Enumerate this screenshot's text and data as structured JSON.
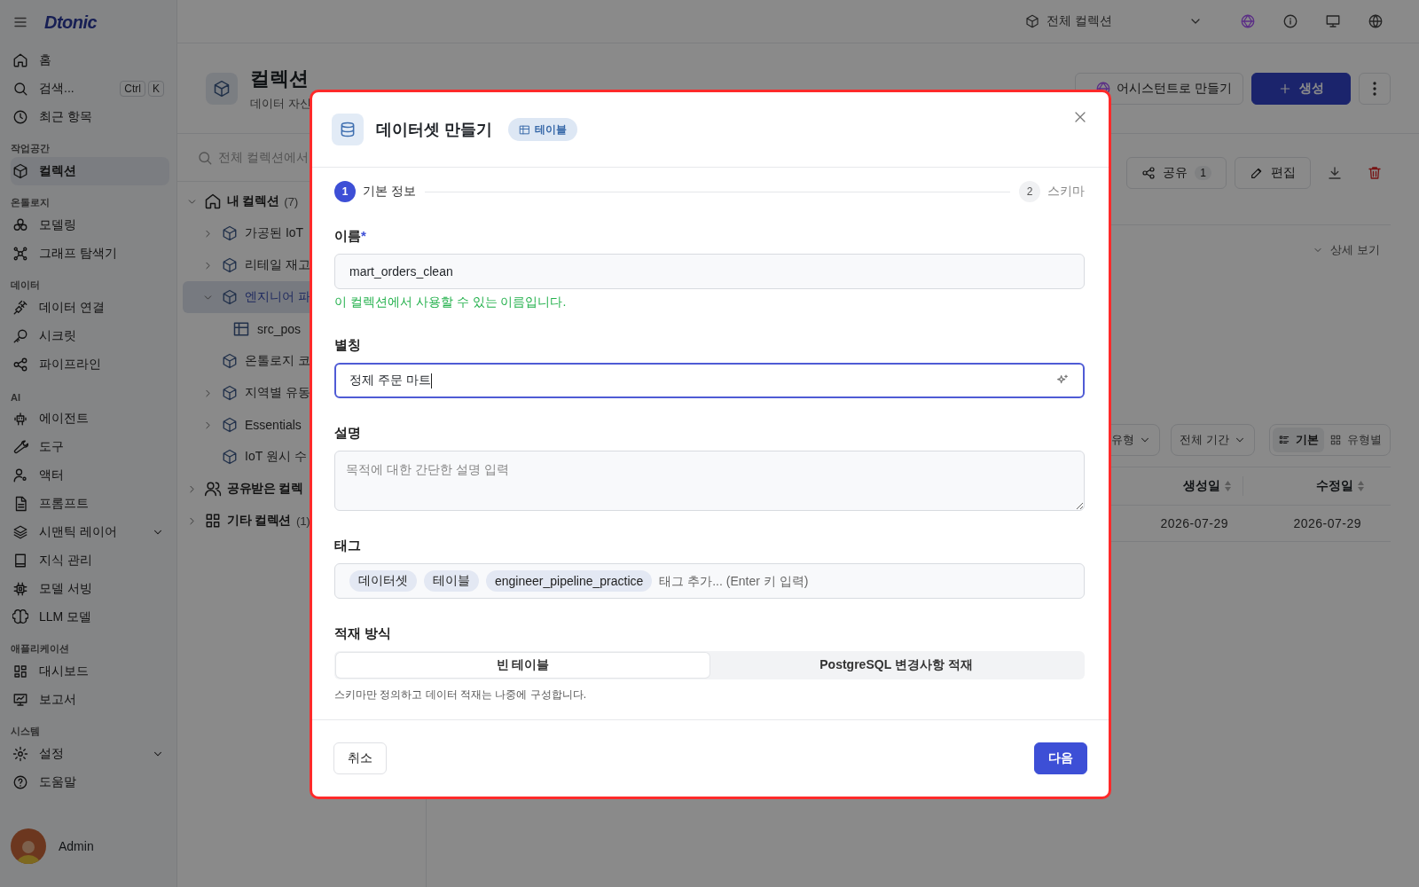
{
  "sidebar": {
    "logo": "Dtonic",
    "items": [
      {
        "kind": "item",
        "label": "홈",
        "selected": false,
        "submenu": false
      },
      {
        "kind": "item",
        "label": "검색...",
        "selected": false,
        "submenu": false,
        "shortcut": [
          "Ctrl",
          "K"
        ]
      },
      {
        "kind": "item",
        "label": "최근 항목",
        "selected": false,
        "submenu": false
      },
      {
        "kind": "section",
        "label": "작업공간"
      },
      {
        "kind": "item",
        "label": "컬렉션",
        "selected": true,
        "submenu": false
      },
      {
        "kind": "section",
        "label": "온톨로지"
      },
      {
        "kind": "item",
        "label": "모델링",
        "selected": false,
        "submenu": false
      },
      {
        "kind": "item",
        "label": "그래프 탐색기",
        "selected": false,
        "submenu": false
      },
      {
        "kind": "section",
        "label": "데이터"
      },
      {
        "kind": "item",
        "label": "데이터 연결",
        "selected": false,
        "submenu": false
      },
      {
        "kind": "item",
        "label": "시크릿",
        "selected": false,
        "submenu": false
      },
      {
        "kind": "item",
        "label": "파이프라인",
        "selected": false,
        "submenu": false
      },
      {
        "kind": "section",
        "label": "AI"
      },
      {
        "kind": "item",
        "label": "에이전트",
        "selected": false,
        "submenu": false
      },
      {
        "kind": "item",
        "label": "도구",
        "selected": false,
        "submenu": false
      },
      {
        "kind": "item",
        "label": "액터",
        "selected": false,
        "submenu": false
      },
      {
        "kind": "item",
        "label": "프롬프트",
        "selected": false,
        "submenu": false
      },
      {
        "kind": "item",
        "label": "시맨틱 레이어",
        "selected": false,
        "submenu": true
      },
      {
        "kind": "item",
        "label": "지식 관리",
        "selected": false,
        "submenu": false
      },
      {
        "kind": "item",
        "label": "모델 서빙",
        "selected": false,
        "submenu": false
      },
      {
        "kind": "item",
        "label": "LLM 모델",
        "selected": false,
        "submenu": false
      },
      {
        "kind": "section",
        "label": "애플리케이션"
      },
      {
        "kind": "item",
        "label": "대시보드",
        "selected": false,
        "submenu": false
      },
      {
        "kind": "item",
        "label": "보고서",
        "selected": false,
        "submenu": false
      },
      {
        "kind": "section",
        "label": "시스템"
      },
      {
        "kind": "item",
        "label": "설정",
        "selected": false,
        "submenu": true
      },
      {
        "kind": "item",
        "label": "도움말",
        "selected": false,
        "submenu": false
      }
    ],
    "user": {
      "name": "Admin"
    }
  },
  "topbar": {
    "scope": "전체 컬렉션"
  },
  "page": {
    "title": "컬렉션",
    "subtitle": "데이터 자신",
    "actions": [
      {
        "kind": "assistant",
        "label": "어시스턴트로 만들기"
      },
      {
        "kind": "primary",
        "label": "생성"
      },
      {
        "kind": "more"
      }
    ]
  },
  "tree": {
    "search_placeholder": "전체 컬렉션에서",
    "groups": [
      {
        "kind": "home",
        "label": "내 컬렉션",
        "count": "(7)",
        "expanded": true,
        "children": [
          {
            "label": "가공된 IoT",
            "has_children": true,
            "expanded": false,
            "selected": false
          },
          {
            "label": "리테일 재고",
            "has_children": true,
            "expanded": false,
            "selected": false
          },
          {
            "label": "엔지니어 파",
            "has_children": true,
            "expanded": true,
            "selected": true,
            "children": [
              {
                "label": "src_pos",
                "selected": false
              }
            ]
          },
          {
            "label": "온톨로지 코",
            "has_children": false,
            "expanded": false,
            "selected": false
          },
          {
            "label": "지역별 유동",
            "has_children": true,
            "expanded": false,
            "selected": false
          },
          {
            "label": "Essentials",
            "has_children": true,
            "expanded": false,
            "selected": false
          },
          {
            "label": "IoT 원시 수",
            "has_children": false,
            "expanded": false,
            "selected": false
          }
        ]
      },
      {
        "kind": "shared",
        "label": "공유받은 컬렉",
        "expanded": false
      },
      {
        "kind": "other",
        "label": "기타 컬렉션",
        "count": "(1)",
        "expanded": false
      }
    ]
  },
  "content": {
    "toolbar": [
      {
        "kind": "share",
        "label": "공유",
        "count": "1"
      },
      {
        "kind": "edit",
        "label": "편집"
      },
      {
        "kind": "download"
      },
      {
        "kind": "delete"
      }
    ],
    "detail_toggle": "상세 보기",
    "filters": [
      {
        "label": "유형"
      },
      {
        "label": "전체 기간"
      }
    ],
    "view_modes": [
      {
        "kind": "list",
        "label": "기본",
        "selected": true
      },
      {
        "kind": "grid",
        "label": "유형별",
        "selected": false
      }
    ],
    "table": {
      "columns": [
        "생성일",
        "수정일"
      ],
      "rows": [
        [
          "2026-07-29",
          "2026-07-29"
        ]
      ]
    }
  },
  "dialog": {
    "title": "데이터셋 만들기",
    "badge": "테이블",
    "steps": [
      {
        "number": "1",
        "label": "기본 정보",
        "selected": true
      },
      {
        "number": "2",
        "label": "스키마",
        "selected": false
      }
    ],
    "name": {
      "label": "이름",
      "required_mark": "*",
      "value": "mart_orders_clean",
      "hint": "이 컬렉션에서 사용할 수 있는 이름입니다."
    },
    "alias": {
      "label": "별칭",
      "value": "정제 주문 마트",
      "focused": true
    },
    "description": {
      "label": "설명",
      "placeholder": "목적에 대한 간단한 설명 입력"
    },
    "tags": {
      "label": "태그",
      "tags": [
        "데이터셋",
        "테이블",
        "engineer_pipeline_practice"
      ],
      "placeholder": "태그 추가... (Enter 키 입력)"
    },
    "load_mode": {
      "label": "적재 방식",
      "options": [
        {
          "label": "빈 테이블",
          "selected": true
        },
        {
          "label": "PostgreSQL 변경사항 적재",
          "selected": false
        }
      ],
      "hint": "스키마만 정의하고 데이터 적재는 나중에 구성합니다."
    },
    "buttons": [
      {
        "kind": "cancel",
        "label": "취소"
      },
      {
        "kind": "next",
        "label": "다음"
      }
    ]
  }
}
